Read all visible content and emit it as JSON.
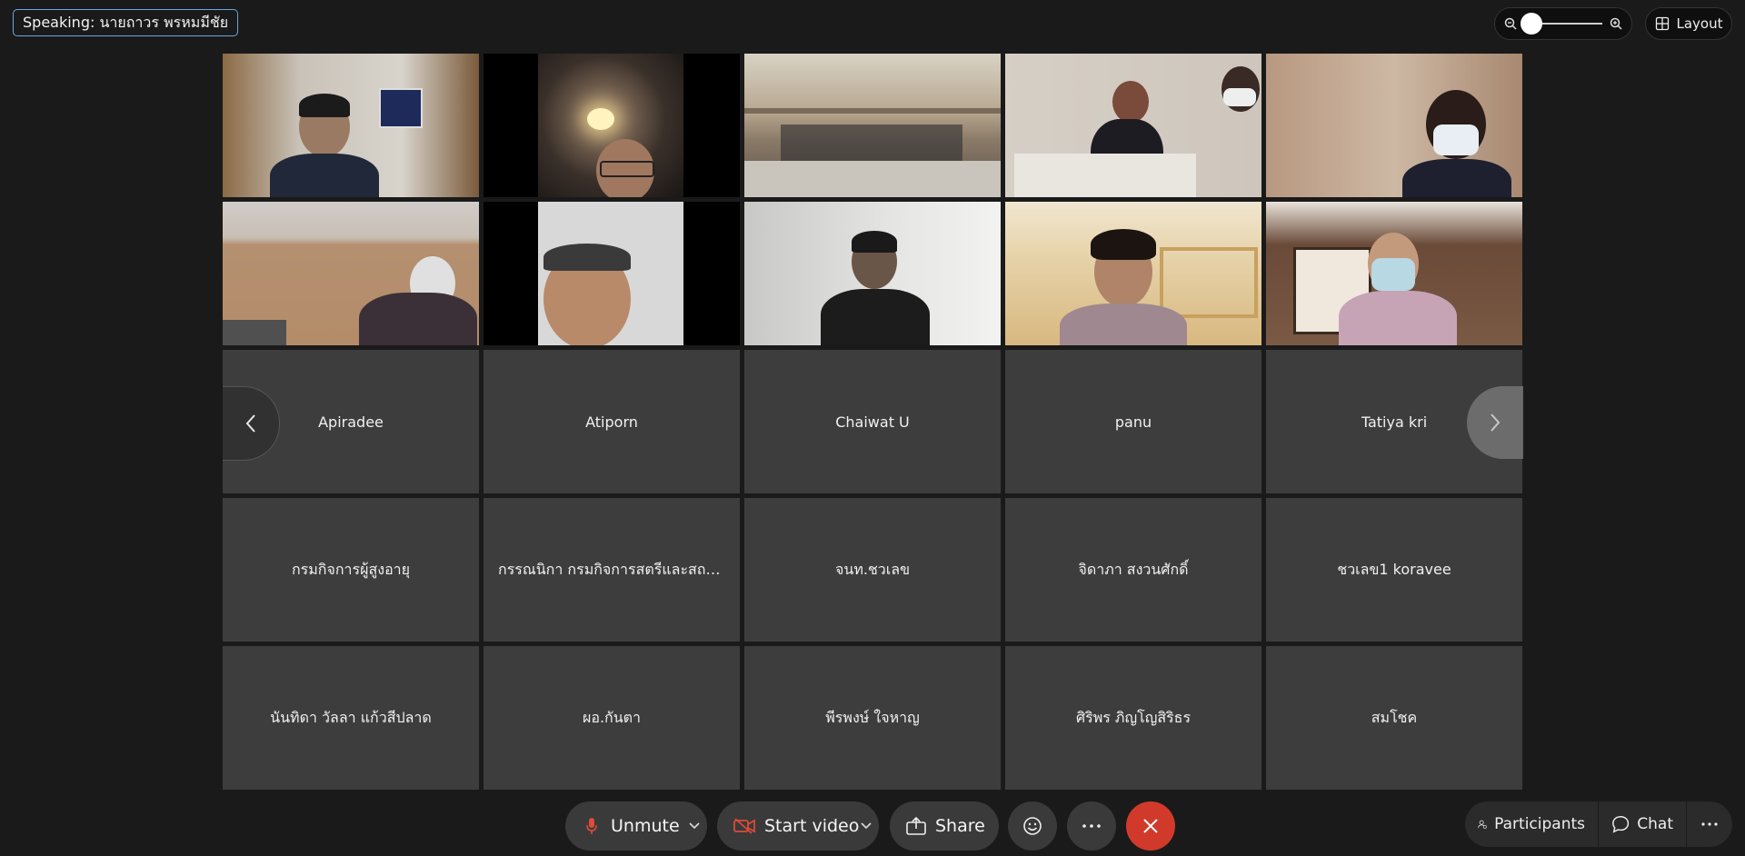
{
  "speaking_label": "Speaking: นายถาวร พรหมมีชัย",
  "layout_label": "Layout",
  "video_tiles_count_note": "",
  "participants_no_video": {
    "row3": [
      "Apiradee",
      "Atiporn",
      "Chaiwat U",
      "panu",
      "Tatiya kri"
    ],
    "row4": [
      "กรมกิจการผู้สูงอายุ",
      "กรรณนิกา กรมกิจการสตรีและสถา...",
      "จนท.ชวเลข",
      "จิดาภา สงวนศักดิ์",
      "ชวเลข1 koravee"
    ],
    "row5": [
      "นันทิดา วัลลา แก้วสีปลาด",
      "ผอ.กันตา",
      "พีรพงษ์ ใจหาญ",
      "ศิริพร ภิญโญสิริธร",
      "สมโชค"
    ]
  },
  "toolbar": {
    "unmute_label": "Unmute",
    "start_video_label": "Start video",
    "share_label": "Share"
  },
  "right_bar": {
    "participants_label": "Participants",
    "chat_label": "Chat"
  },
  "colors": {
    "end_call": "#d13a2a",
    "mic_muted": "#e04a3a",
    "speaking_border": "#6aa6e0"
  }
}
